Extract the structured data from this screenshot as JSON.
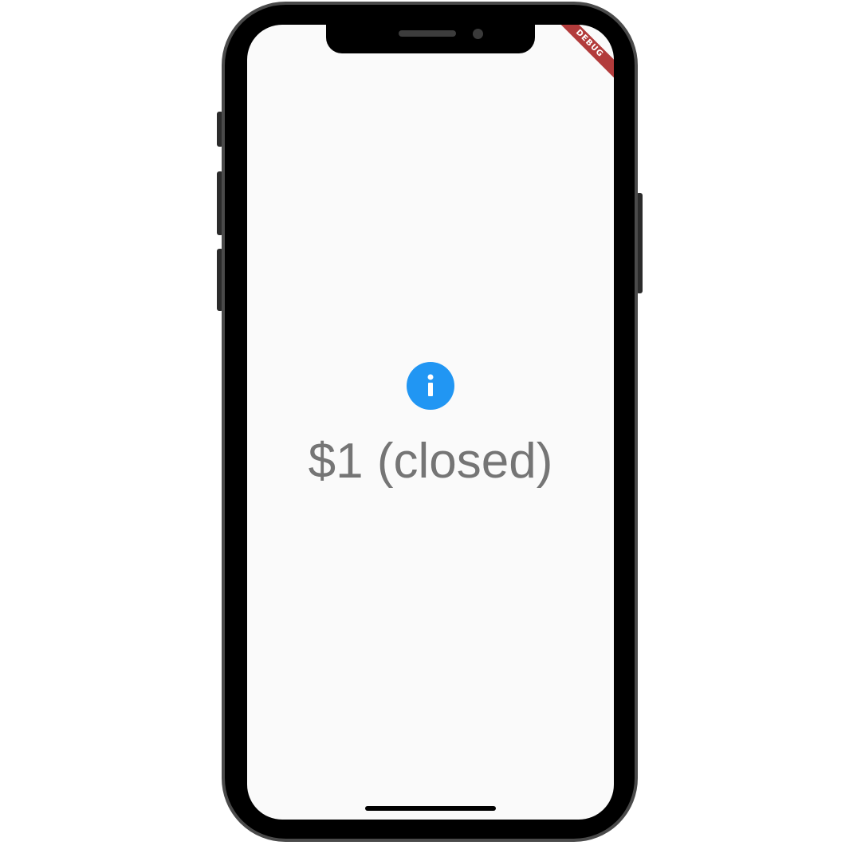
{
  "app": {
    "debug_banner": "DEBUG",
    "status_text": "$1 (closed)",
    "info_icon": "info-circle-icon"
  },
  "colors": {
    "accent": "#2196f3",
    "text": "#757575",
    "screen_background": "#fafafa",
    "debug_banner": "#b23b3b"
  }
}
